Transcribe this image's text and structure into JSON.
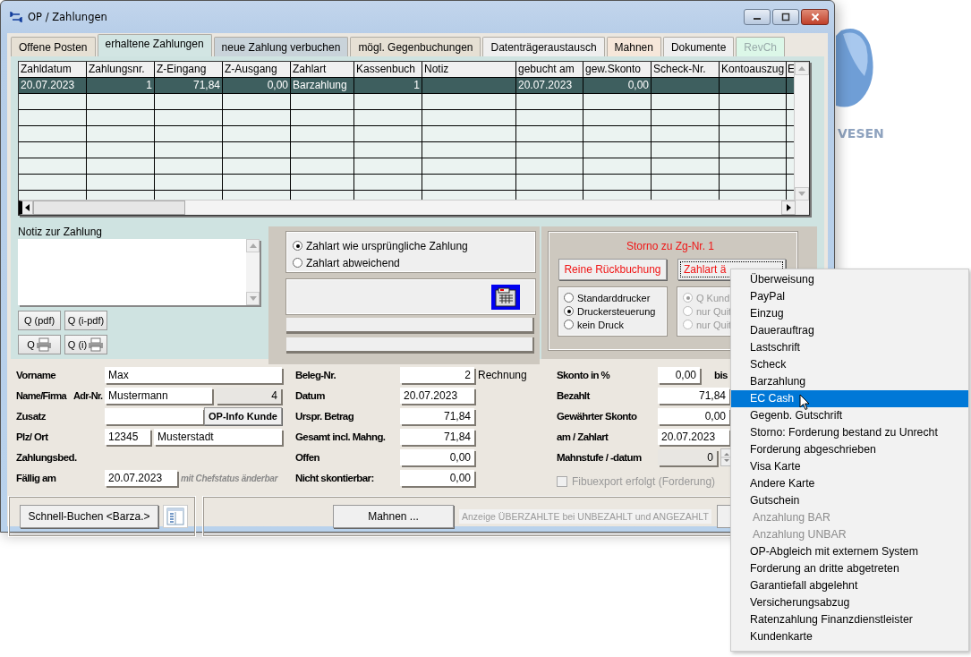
{
  "window": {
    "title": "OP / Zahlungen"
  },
  "background": {
    "text": "VESEN"
  },
  "tabs": [
    {
      "label": "Offene Posten",
      "selected": false,
      "disabled": false,
      "color": "#e6e0d4"
    },
    {
      "label": "erhaltene Zahlungen",
      "selected": true,
      "disabled": false,
      "color": "#d2e5e3"
    },
    {
      "label": "neue Zahlung verbuchen",
      "selected": false,
      "disabled": false,
      "color": "#c9d3da"
    },
    {
      "label": "mögl. Gegenbuchungen",
      "selected": false,
      "disabled": false,
      "color": "#e6e0d4"
    },
    {
      "label": "Datenträgeraustausch",
      "selected": false,
      "disabled": false,
      "color": "#efefef"
    },
    {
      "label": "Mahnen",
      "selected": false,
      "disabled": false,
      "color": "#f6e7da"
    },
    {
      "label": "Dokumente",
      "selected": false,
      "disabled": false,
      "color": "#efefef"
    },
    {
      "label": "RevCh",
      "selected": false,
      "disabled": true,
      "color": "#dcf7e8"
    }
  ],
  "payments_grid": {
    "columns": [
      "Zahldatum",
      "Zahlungsnr.",
      "Z-Eingang",
      "Z-Ausgang",
      "Zahlart",
      "Kassenbuch",
      "Notiz",
      "gebucht am",
      "gew.Skonto",
      "Scheck-Nr.",
      "Kontoauszug",
      "E"
    ],
    "rows": [
      {
        "selected": true,
        "cells": [
          "20.07.2023",
          "1",
          "71,84",
          "0,00",
          "Barzahlung",
          "1",
          null,
          "20.07.2023",
          "0,00",
          null,
          null,
          null
        ]
      }
    ]
  },
  "note": {
    "label": "Notiz zur Zahlung"
  },
  "print_buttons": [
    {
      "label": "Q (pdf)",
      "kind": "text"
    },
    {
      "label": "Q (i-pdf)",
      "kind": "text"
    },
    {
      "label": "Q",
      "kind": "printer"
    },
    {
      "label": "Q (i)",
      "kind": "printer"
    }
  ],
  "payment_mode": [
    {
      "label": "Zahlart wie ursprüngliche Zahlung",
      "selected": true
    },
    {
      "label": "Zahlart abweichend",
      "selected": false
    }
  ],
  "storno": {
    "title": "Storno zu Zg-Nr. 1",
    "buttons": [
      {
        "label": "Reine Rückbuchung",
        "focused": false
      },
      {
        "label": "Zahlart ä",
        "focused": true
      }
    ],
    "printer_options": {
      "disabled": false,
      "items": [
        {
          "label": "Standarddrucker",
          "selected": false
        },
        {
          "label": "Druckersteuerung",
          "selected": true
        },
        {
          "label": "kein Druck",
          "selected": false
        }
      ]
    },
    "receipt_options": {
      "disabled": true,
      "items": [
        {
          "label": "Q Kund",
          "selected": true
        },
        {
          "label": "nur Quit",
          "selected": false
        },
        {
          "label": "nur Quit",
          "selected": false
        }
      ]
    }
  },
  "customer": {
    "first_name": {
      "label": "Vorname",
      "value": "Max"
    },
    "name": {
      "label": "Name/Firma",
      "value": "Mustermann"
    },
    "address_no": {
      "label": "Adr-Nr.",
      "value": "4"
    },
    "extra": {
      "label": "Zusatz"
    },
    "info_button": "OP-Info Kunde",
    "city": {
      "label": "Plz/ Ort",
      "zip": "12345",
      "city": "Musterstadt"
    },
    "terms": {
      "label": "Zahlungsbed."
    },
    "due": {
      "label": "Fällig am",
      "value": "20.07.2023",
      "note": "mit Chefstatus änderbar"
    }
  },
  "document": [
    {
      "label": "Beleg-Nr.",
      "value": "2",
      "kind": "amount",
      "suffix": "Rechnung"
    },
    {
      "label": "Datum",
      "value": "20.07.2023",
      "kind": "date"
    },
    {
      "label": "Urspr. Betrag",
      "value": "71,84",
      "kind": "amount"
    },
    {
      "label": "Gesamt incl. Mahng.",
      "value": "71,84",
      "kind": "amount"
    },
    {
      "label": "Offen",
      "value": "0,00",
      "kind": "amount"
    },
    {
      "label": "Nicht skontierbar:",
      "value": "0,00",
      "kind": "amount"
    }
  ],
  "payment": [
    {
      "label": "Skonto in %",
      "value": "0,00",
      "kind": "short",
      "suffix": "bis"
    },
    {
      "label": "Bezahlt",
      "value": "71,84",
      "kind": "amount"
    },
    {
      "label": "Gewährter Skonto",
      "value": "0,00",
      "kind": "amount"
    },
    {
      "label": "am / Zahlart",
      "value": "20.07.2023",
      "kind": "date"
    },
    {
      "label": "Mahnstufe / -datum",
      "value": "0",
      "kind": "spinner"
    }
  ],
  "fibu_export": {
    "label": "Fibuexport erfolgt (Forderung)",
    "checked": false,
    "disabled": true
  },
  "bottom": {
    "quick_book": "Schnell-Buchen <Barza.>",
    "dunning": "Mahnen ...",
    "overpaid_hint": "Anzeige ÜBERZAHLTE bei UNBEZAHLT und ANGEZAHLT"
  },
  "menu": {
    "items": [
      {
        "label": "Überweisung",
        "selected": false,
        "disabled": false
      },
      {
        "label": "PayPal",
        "selected": false,
        "disabled": false
      },
      {
        "label": "Einzug",
        "selected": false,
        "disabled": false
      },
      {
        "label": "Dauerauftrag",
        "selected": false,
        "disabled": false
      },
      {
        "label": "Lastschrift",
        "selected": false,
        "disabled": false
      },
      {
        "label": "Scheck",
        "selected": false,
        "disabled": false
      },
      {
        "label": "Barzahlung",
        "selected": false,
        "disabled": false
      },
      {
        "label": "EC Cash",
        "selected": true,
        "disabled": false
      },
      {
        "label": "Gegenb. Gutschrift",
        "selected": false,
        "disabled": false
      },
      {
        "label": "Storno: Forderung bestand zu Unrecht",
        "selected": false,
        "disabled": false
      },
      {
        "label": "Forderung abgeschrieben",
        "selected": false,
        "disabled": false
      },
      {
        "label": "Visa Karte",
        "selected": false,
        "disabled": false
      },
      {
        "label": "Andere Karte",
        "selected": false,
        "disabled": false
      },
      {
        "label": "Gutschein",
        "selected": false,
        "disabled": false
      },
      {
        "label": "Anzahlung BAR",
        "selected": false,
        "disabled": true
      },
      {
        "label": "Anzahlung UNBAR",
        "selected": false,
        "disabled": true
      },
      {
        "label": "OP-Abgleich mit externem System",
        "selected": false,
        "disabled": false
      },
      {
        "label": "Forderung an dritte abgetreten",
        "selected": false,
        "disabled": false
      },
      {
        "label": "Garantiefall abgelehnt",
        "selected": false,
        "disabled": false
      },
      {
        "label": "Versicherungsabzug",
        "selected": false,
        "disabled": false
      },
      {
        "label": "Ratenzahlung Finanzdienstleister",
        "selected": false,
        "disabled": false
      },
      {
        "label": "Kundenkarte",
        "selected": false,
        "disabled": false
      }
    ]
  }
}
